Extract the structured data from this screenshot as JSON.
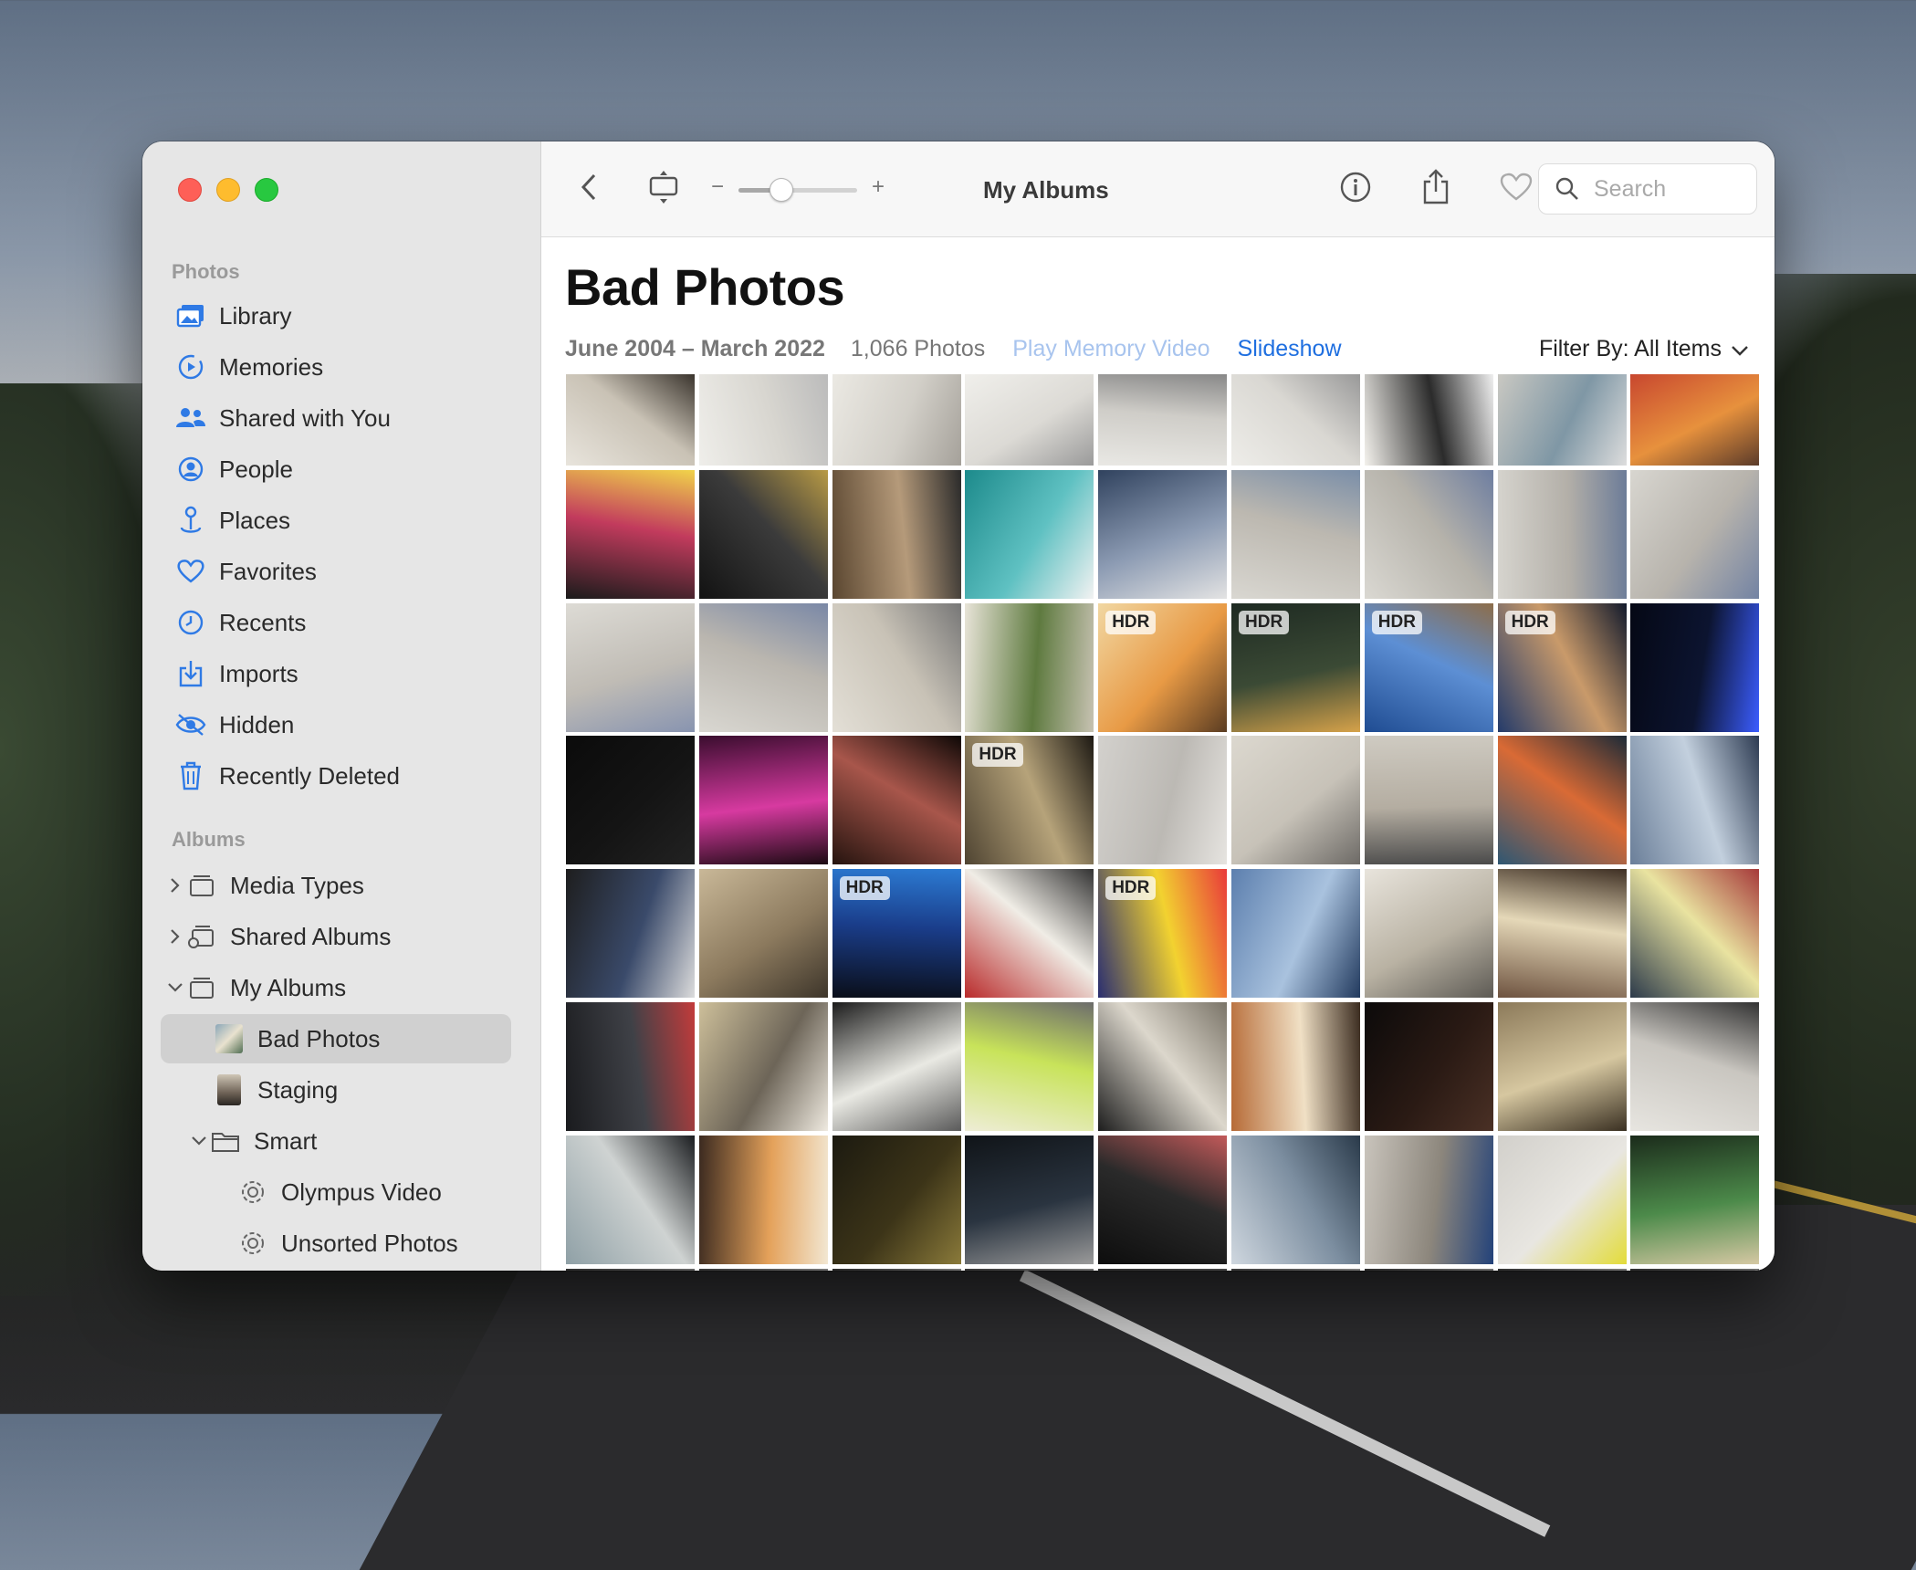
{
  "window": {
    "toolbar": {
      "title": "My Albums",
      "zoom_minus": "−",
      "zoom_plus": "+",
      "zoom_level": 0.35,
      "search_placeholder": "Search",
      "icons": [
        "back-chevron-icon",
        "slideshow-fit-icon",
        "info-icon",
        "share-icon",
        "heart-icon",
        "rotate-icon",
        "search-icon"
      ]
    },
    "sidebar": {
      "photos_header": "Photos",
      "photos_items": [
        {
          "label": "Library",
          "icon": "library-icon",
          "color": "#2f7ae5"
        },
        {
          "label": "Memories",
          "icon": "memories-icon",
          "color": "#2f7ae5"
        },
        {
          "label": "Shared with You",
          "icon": "shared-with-you-icon",
          "color": "#2f7ae5"
        },
        {
          "label": "People",
          "icon": "people-icon",
          "color": "#2f7ae5"
        },
        {
          "label": "Places",
          "icon": "places-icon",
          "color": "#2f7ae5"
        },
        {
          "label": "Favorites",
          "icon": "heart-icon",
          "color": "#2f7ae5"
        },
        {
          "label": "Recents",
          "icon": "clock-icon",
          "color": "#2f7ae5"
        },
        {
          "label": "Imports",
          "icon": "import-icon",
          "color": "#2f7ae5"
        },
        {
          "label": "Hidden",
          "icon": "hidden-eye-icon",
          "color": "#2f7ae5"
        },
        {
          "label": "Recently Deleted",
          "icon": "trash-icon",
          "color": "#2f7ae5"
        }
      ],
      "albums_header": "Albums",
      "albums_items": [
        {
          "label": "Media Types",
          "expander": "collapsed"
        },
        {
          "label": "Shared Albums",
          "expander": "collapsed"
        },
        {
          "label": "My Albums",
          "expander": "expanded"
        },
        {
          "label": "Bad Photos",
          "selected": true
        },
        {
          "label": "Staging"
        },
        {
          "label": "Smart",
          "expander": "expanded"
        },
        {
          "label": "Olympus Video"
        },
        {
          "label": "Unsorted Photos"
        }
      ]
    },
    "album": {
      "title": "Bad Photos",
      "date_range": "June 2004 – March 2022",
      "photo_count": "1,066 Photos",
      "play_memory_video": "Play Memory Video",
      "slideshow": "Slideshow",
      "filter_by": "Filter By: All Items",
      "hdr_badge": "HDR"
    }
  }
}
